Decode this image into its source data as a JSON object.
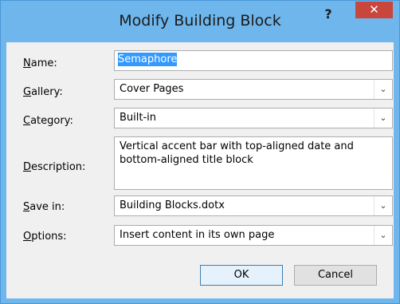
{
  "window": {
    "title": "Modify Building Block",
    "help_glyph": "?",
    "close_glyph": "✕"
  },
  "form": {
    "name": {
      "label_accel": "N",
      "label_rest": "ame:",
      "value": "Semaphore"
    },
    "gallery": {
      "label_accel": "G",
      "label_rest": "allery:",
      "value": "Cover Pages"
    },
    "category": {
      "label_accel": "C",
      "label_rest": "ategory:",
      "value": "Built-in"
    },
    "description": {
      "label_accel": "D",
      "label_rest": "escription:",
      "value": "Vertical accent bar with top-aligned date and bottom-aligned title block"
    },
    "save_in": {
      "label_accel": "S",
      "label_rest": "ave in:",
      "value": "Building Blocks.dotx"
    },
    "options": {
      "label_accel": "O",
      "label_rest": "ptions:",
      "value": "Insert content in its own page"
    }
  },
  "buttons": {
    "ok": "OK",
    "cancel": "Cancel"
  },
  "icons": {
    "dropdown": "chevron-down-icon"
  },
  "colors": {
    "titlebar": "#6fb6ec",
    "close": "#c9463d",
    "selection": "#3399ff"
  }
}
